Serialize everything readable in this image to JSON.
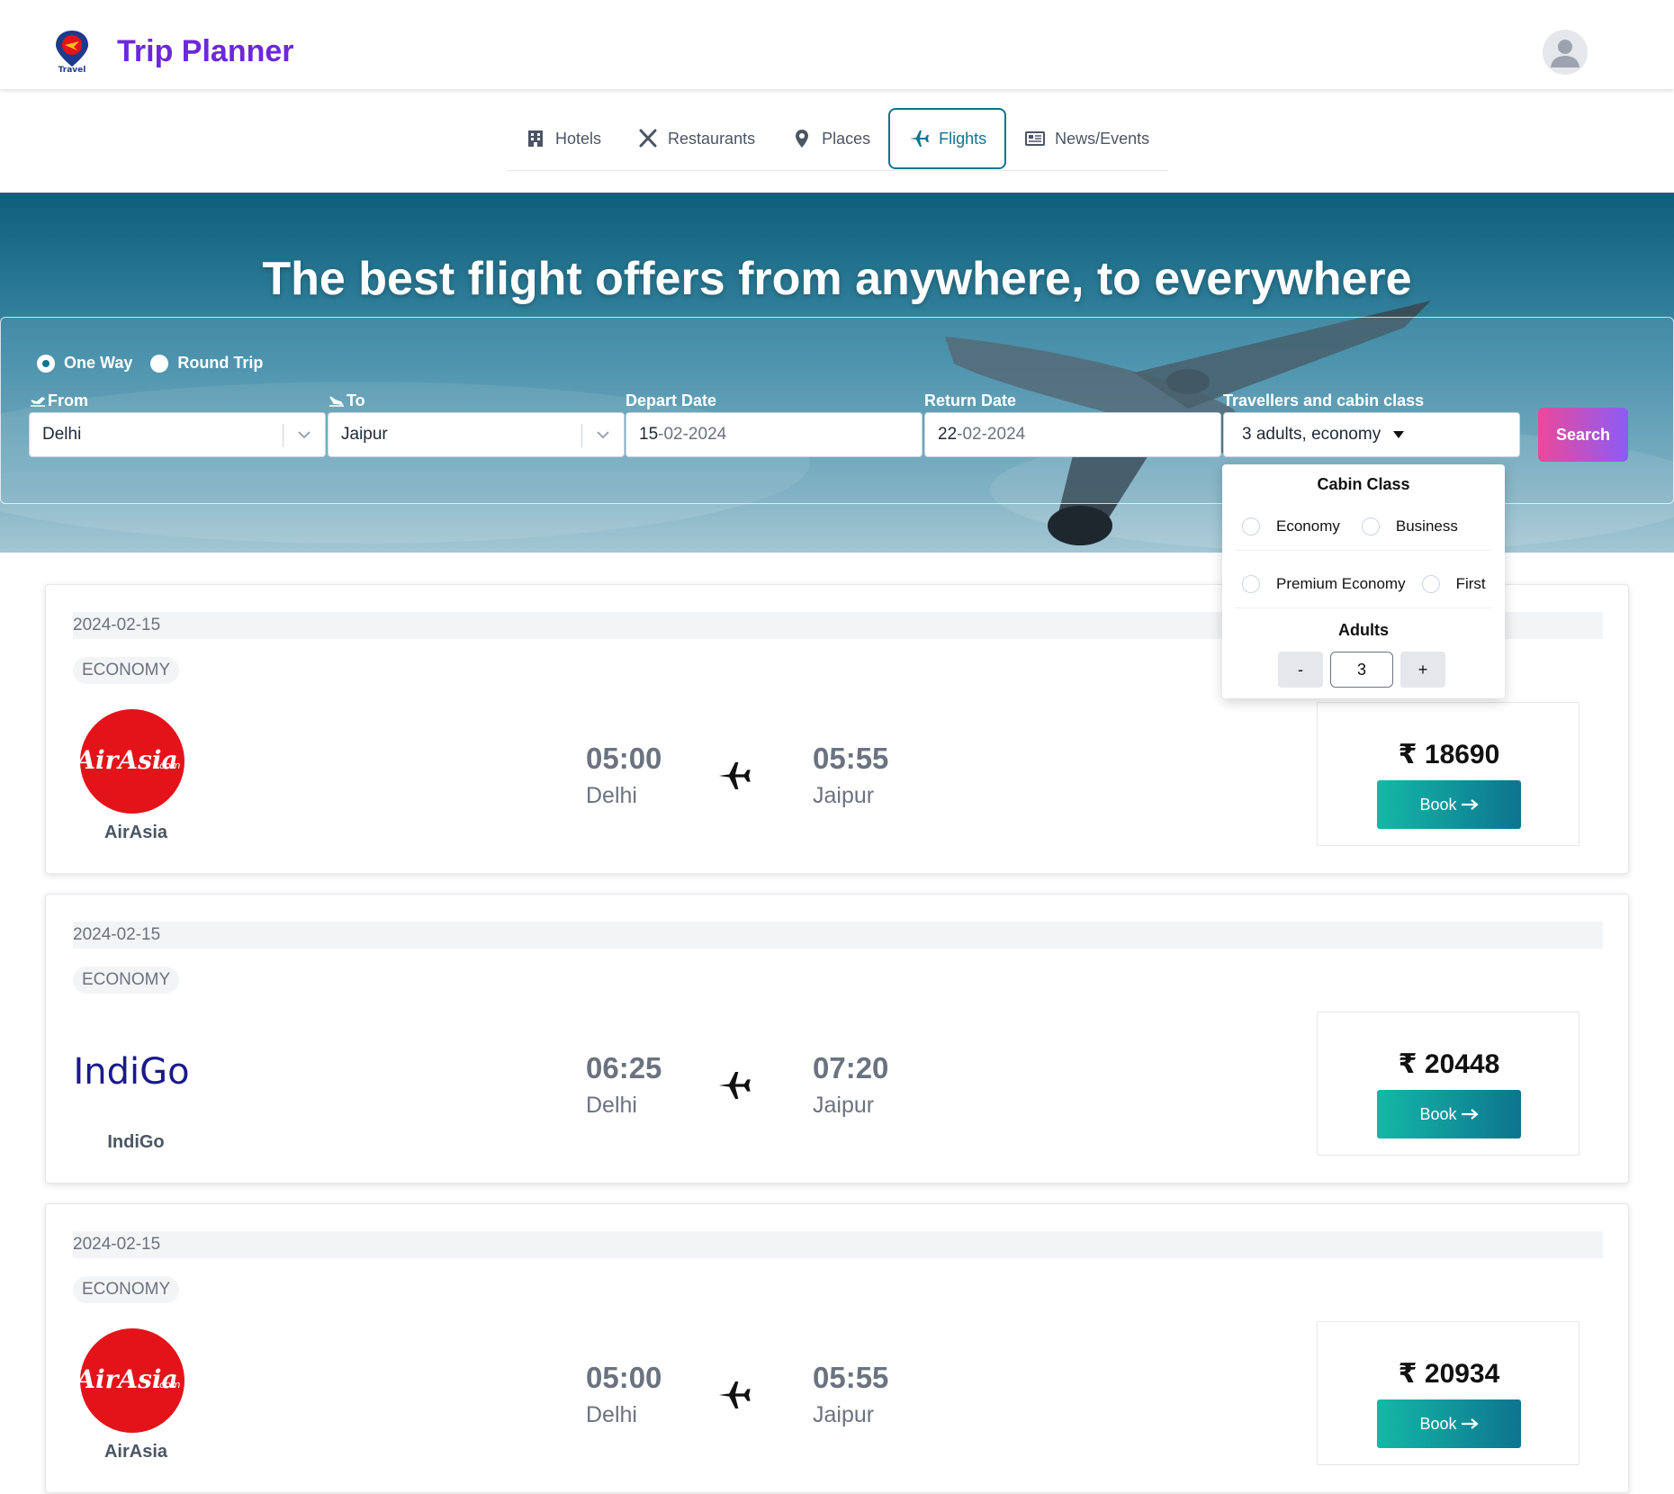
{
  "app": {
    "title": "Trip Planner",
    "logo_text": "Travel"
  },
  "tabs": [
    {
      "label": "Hotels",
      "icon": "building-icon"
    },
    {
      "label": "Restaurants",
      "icon": "utensils-icon"
    },
    {
      "label": "Places",
      "icon": "map-pin-icon"
    },
    {
      "label": "Flights",
      "icon": "plane-icon",
      "active": true
    },
    {
      "label": "News/Events",
      "icon": "newspaper-icon"
    }
  ],
  "hero": {
    "title": "The best flight offers from anywhere, to everywhere"
  },
  "search": {
    "trip_types": [
      "One Way",
      "Round Trip"
    ],
    "selected_trip_type": "One Way",
    "from_label": "From",
    "to_label": "To",
    "depart_label": "Depart Date",
    "return_label": "Return Date",
    "travellers_label": "Travellers and cabin class",
    "from_value": "Delhi",
    "to_value": "Jaipur",
    "depart_day": "15",
    "depart_rest": "-02-2024",
    "return_day": "22",
    "return_rest": "-02-2024",
    "travellers_value": "3 adults, economy",
    "search_label": "Search"
  },
  "dropdown": {
    "cabin_title": "Cabin Class",
    "options": [
      "Economy",
      "Business",
      "Premium Economy",
      "First"
    ],
    "adults_title": "Adults",
    "minus": "-",
    "plus": "+",
    "adults_value": "3"
  },
  "results": [
    {
      "date": "2024-02-15",
      "class": "ECONOMY",
      "airline": "AirAsia",
      "logo_text": "AirAsia",
      "logo_suffix": ".com",
      "depart_time": "05:00",
      "depart_city": "Delhi",
      "arrive_time": "05:55",
      "arrive_city": "Jaipur",
      "price": "₹ 18690",
      "book": "Book"
    },
    {
      "date": "2024-02-15",
      "class": "ECONOMY",
      "airline": "IndiGo",
      "logo_text": "IndiGo",
      "depart_time": "06:25",
      "depart_city": "Delhi",
      "arrive_time": "07:20",
      "arrive_city": "Jaipur",
      "price": "₹ 20448",
      "book": "Book"
    },
    {
      "date": "2024-02-15",
      "class": "ECONOMY",
      "airline": "AirAsia",
      "logo_text": "AirAsia",
      "logo_suffix": ".com",
      "depart_time": "05:00",
      "depart_city": "Delhi",
      "arrive_time": "05:55",
      "arrive_city": "Jaipur",
      "price": "₹ 20934",
      "book": "Book"
    }
  ],
  "colors": {
    "brand": "#6d28d9",
    "accent": "#0e7490",
    "book_start": "#14b8a6",
    "book_end": "#0e7490",
    "search_start": "#ec4899",
    "search_end": "#8b5cf6",
    "airasia_red": "#e4131a",
    "indigo_blue": "#1a1a8c"
  }
}
